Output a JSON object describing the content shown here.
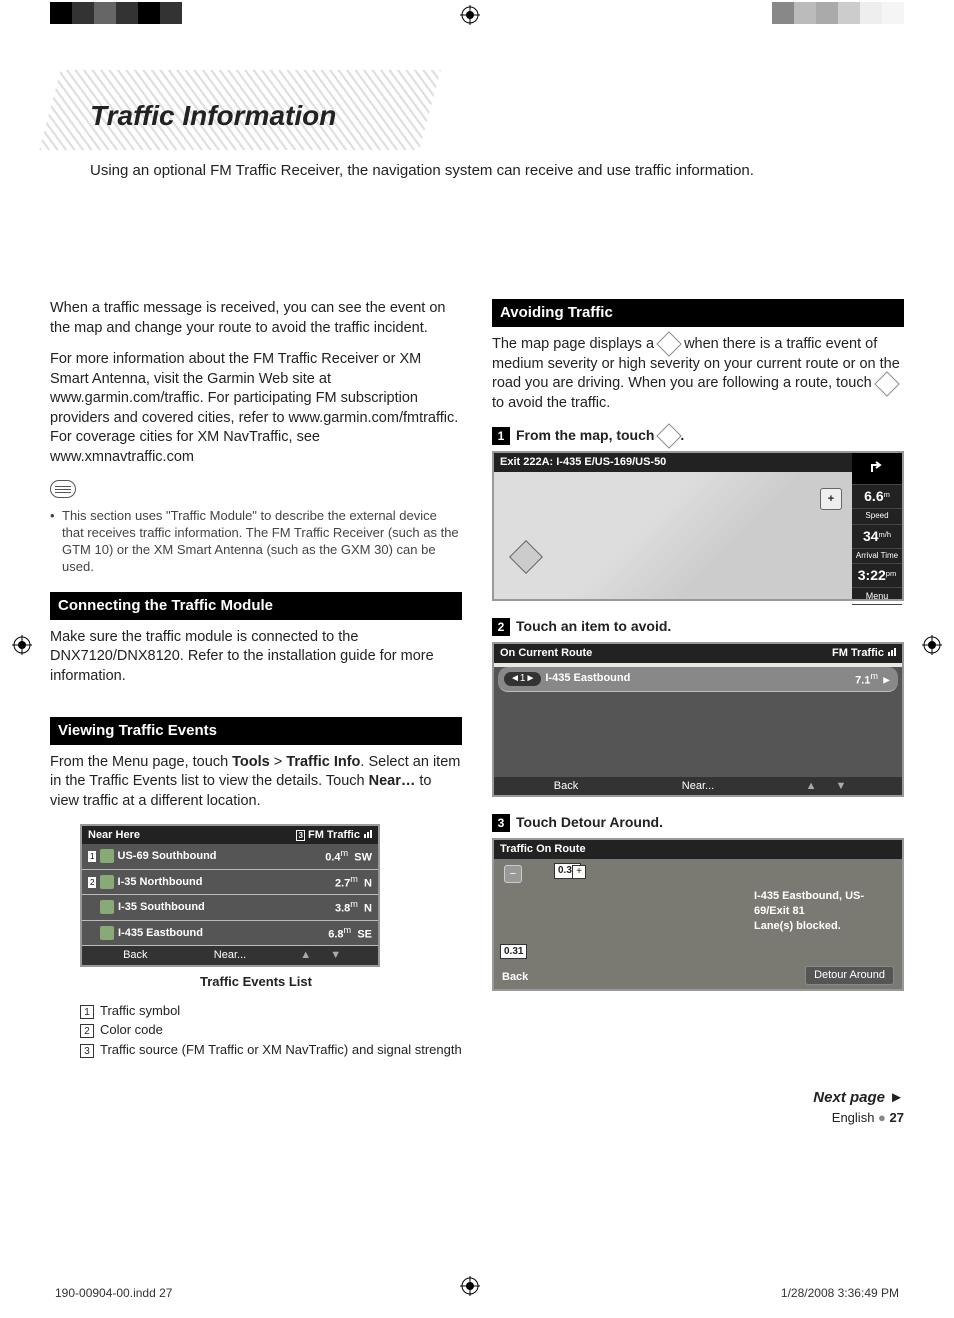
{
  "page_title": "Traffic Information",
  "intro": "Using an optional FM Traffic Receiver, the navigation system can receive and use traffic information.",
  "left_col": {
    "p1": "When a traffic message is received, you can see the event on the map and change your route to avoid the traffic incident.",
    "p2": "For more information about the FM Traffic Receiver or XM Smart Antenna, visit the Garmin Web site at www.garmin.com/traffic. For participating FM subscription providers and covered cities, refer to www.garmin.com/fmtraffic. For coverage cities for XM NavTraffic, see www.xmnavtraffic.com",
    "note": "This section uses \"Traffic Module\" to describe the external device that receives traffic information. The FM Traffic Receiver (such as the GTM 10) or the XM Smart Antenna (such as the GXM 30) can be used.",
    "h_connect": "Connecting the Traffic Module",
    "p_connect": "Make sure the traffic module is connected to the DNX7120/DNX8120. Refer to the installation guide for more information.",
    "h_view": "Viewing Traffic Events",
    "p_view_pre": "From the Menu page, touch ",
    "p_view_b1": "Tools",
    "p_view_gt": " > ",
    "p_view_b2": "Traffic Info",
    "p_view_post": ". Select an item in the Traffic Events list to view the details. Touch ",
    "p_view_b3": "Near…",
    "p_view_end": " to view traffic at a different location.",
    "ss1": {
      "hdr_left": "Near Here",
      "hdr_right": "FM Traffic",
      "rows": [
        {
          "name": "US-69 Southbound",
          "dist": "0.4",
          "unit": "m",
          "dir": "SW"
        },
        {
          "name": "I-35 Northbound",
          "dist": "2.7",
          "unit": "m",
          "dir": "N"
        },
        {
          "name": "I-35 Southbound",
          "dist": "3.8",
          "unit": "m",
          "dir": "N"
        },
        {
          "name": "I-435 Eastbound",
          "dist": "6.8",
          "unit": "m",
          "dir": "SE"
        }
      ],
      "back": "Back",
      "near": "Near..."
    },
    "caption": "Traffic Events List",
    "legend": [
      "Traffic symbol",
      "Color code",
      "Traffic source (FM Traffic or XM NavTraffic) and signal strength"
    ]
  },
  "right_col": {
    "h_avoid": "Avoiding Traffic",
    "p_avoid_1": "The map page displays a ",
    "p_avoid_2": " when there is a traffic event of medium severity or high severity on your current route or on the road you are driving. When you are following a route, touch ",
    "p_avoid_3": " to avoid the traffic.",
    "step1_pre": "From the map, touch ",
    "step1_post": ".",
    "map_ss": {
      "hdr": "Exit 222A: I-435 E/US-169/US-50",
      "dist": "6.6",
      "dist_unit": "m",
      "speed_label": "Speed",
      "speed": "34",
      "speed_unit": "m/h",
      "arrival_label": "Arrival Time",
      "arrival": "3:22",
      "arrival_unit": "pm",
      "menu": "Menu",
      "plus": "+"
    },
    "step2": "Touch an item to avoid.",
    "ss2": {
      "hdr_left": "On Current Route",
      "hdr_right": "FM Traffic",
      "row_name": "I-435 Eastbound",
      "row_dist": "7.1",
      "row_unit": "m",
      "back": "Back",
      "near": "Near..."
    },
    "step3": "Touch Detour Around.",
    "ss3": {
      "hdr": "Traffic On Route",
      "route": "I-435 Eastbound, US-69/Exit 81",
      "lanes": "Lane(s) blocked.",
      "d1": "0.30",
      "d2": "0.31",
      "back": "Back",
      "detour": "Detour Around"
    }
  },
  "footer": {
    "next": "Next page ►",
    "lang": "English",
    "page": "27",
    "indd": "190-00904-00.indd   27",
    "date": "1/28/2008   3:36:49 PM"
  }
}
